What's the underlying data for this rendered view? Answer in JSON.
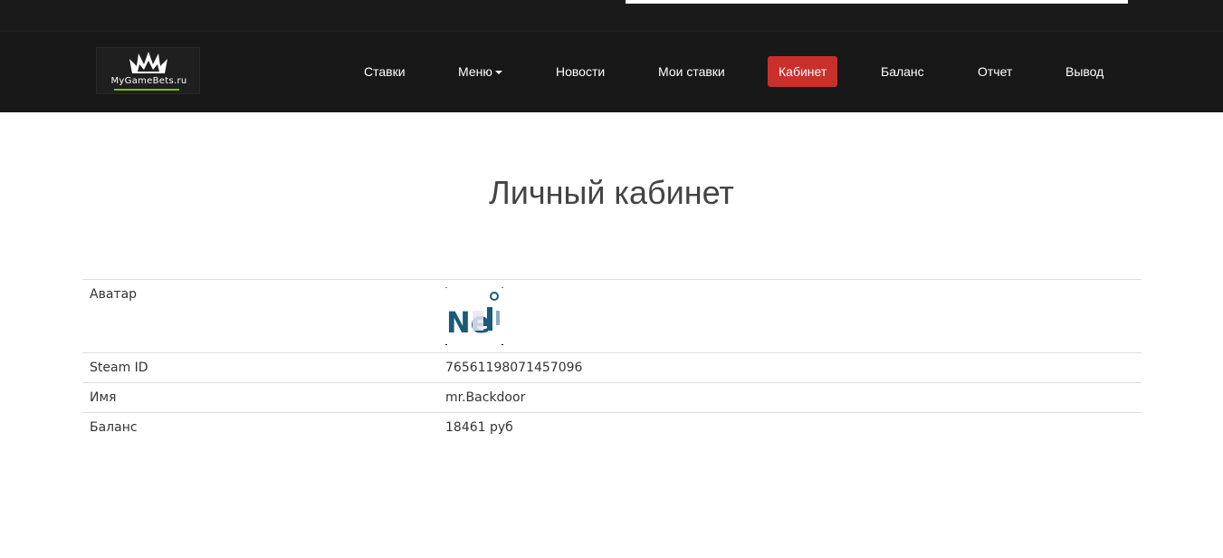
{
  "topbar": {
    "search_value": ""
  },
  "logo": {
    "text": "MyGameBets.ru"
  },
  "nav": {
    "items": [
      {
        "label": "Ставки"
      },
      {
        "label": "Меню"
      },
      {
        "label": "Новости"
      },
      {
        "label": "Мои ставки"
      },
      {
        "label": "Кабинет"
      },
      {
        "label": "Баланс"
      },
      {
        "label": "Отчет"
      },
      {
        "label": "Вывод"
      }
    ],
    "active_item": "Кабинет",
    "active_color": "#c9302c"
  },
  "page": {
    "title": "Личный кабинет"
  },
  "profile": {
    "rows": [
      {
        "label": "Аватар",
        "value": ""
      },
      {
        "label": "Steam ID",
        "value": "76561198071457096"
      },
      {
        "label": "Имя",
        "value": "mr.Backdoor"
      },
      {
        "label": "Баланс",
        "value": "18461 руб"
      }
    ],
    "avatar_text": "Ne"
  }
}
